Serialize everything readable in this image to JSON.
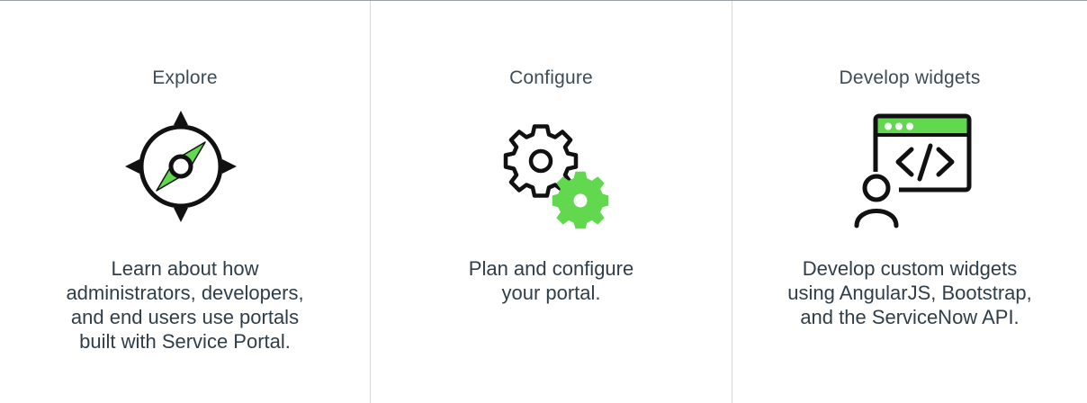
{
  "cards": [
    {
      "title": "Explore",
      "icon": "compass-icon",
      "description": "Learn about how\nadministrators, developers,\nand end users use portals\nbuilt with Service Portal."
    },
    {
      "title": "Configure",
      "icon": "gears-icon",
      "description": "Plan and configure\nyour portal."
    },
    {
      "title": "Develop widgets",
      "icon": "code-window-user-icon",
      "description": "Develop custom widgets\nusing AngularJS, Bootstrap,\nand the ServiceNow API."
    }
  ],
  "colors": {
    "accent": "#62d84e",
    "icon_stroke": "#111111",
    "text": "#2f3e4a",
    "divider": "#d6d9db",
    "top_rule": "#9aa1a6"
  }
}
